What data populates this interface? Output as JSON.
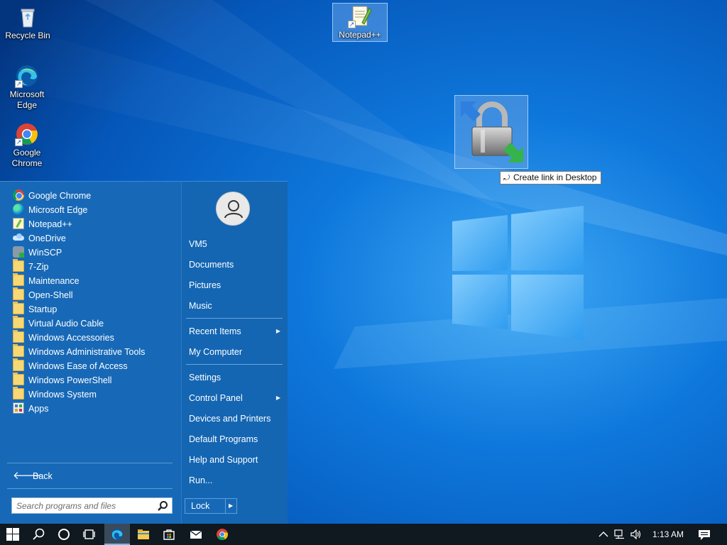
{
  "desktop": {
    "icons": [
      {
        "label": "Recycle Bin",
        "icon": "recycle-bin-icon"
      },
      {
        "label": "Microsoft Edge",
        "icon": "edge-icon"
      },
      {
        "label": "Google Chrome",
        "icon": "chrome-icon"
      },
      {
        "label": "Notepad++",
        "icon": "notepadpp-icon"
      }
    ],
    "drag_tooltip": "Create link in Desktop",
    "drag_item_icon": "winscp-lock-icon"
  },
  "start_menu": {
    "programs": [
      {
        "label": "Google Chrome",
        "icon": "chrome-icon"
      },
      {
        "label": "Microsoft Edge",
        "icon": "edge-icon"
      },
      {
        "label": "Notepad++",
        "icon": "notepadpp-icon"
      },
      {
        "label": "OneDrive",
        "icon": "onedrive-icon"
      },
      {
        "label": "WinSCP",
        "icon": "winscp-icon"
      },
      {
        "label": "7-Zip",
        "icon": "folder-icon"
      },
      {
        "label": "Maintenance",
        "icon": "folder-icon"
      },
      {
        "label": "Open-Shell",
        "icon": "folder-icon"
      },
      {
        "label": "Startup",
        "icon": "folder-icon"
      },
      {
        "label": "Virtual Audio Cable",
        "icon": "folder-icon"
      },
      {
        "label": "Windows Accessories",
        "icon": "folder-icon"
      },
      {
        "label": "Windows Administrative Tools",
        "icon": "folder-icon"
      },
      {
        "label": "Windows Ease of Access",
        "icon": "folder-icon"
      },
      {
        "label": "Windows PowerShell",
        "icon": "folder-icon"
      },
      {
        "label": "Windows System",
        "icon": "folder-icon"
      },
      {
        "label": "Apps",
        "icon": "apps-icon"
      }
    ],
    "back_label": "Back",
    "search_placeholder": "Search programs and files",
    "right": {
      "user": "VM5",
      "documents": "Documents",
      "pictures": "Pictures",
      "music": "Music",
      "recent_items": "Recent Items",
      "my_computer": "My Computer",
      "settings": "Settings",
      "control_panel": "Control Panel",
      "devices_printers": "Devices and Printers",
      "default_programs": "Default Programs",
      "help_support": "Help and Support",
      "run": "Run...",
      "lock": "Lock"
    }
  },
  "taskbar": {
    "buttons": [
      "windows-start-icon",
      "search-icon",
      "cortana-icon",
      "task-view-icon",
      "edge-icon",
      "file-explorer-icon",
      "store-icon",
      "mail-icon",
      "chrome-icon"
    ],
    "clock": "1:13 AM",
    "tray_icons": [
      "chevron-up-icon",
      "network-icon",
      "volume-icon",
      "notifications-icon"
    ]
  },
  "colors": {
    "start_menu_bg": "#1769b7",
    "taskbar_bg": "#101820",
    "wallpaper": "#0b63c9"
  }
}
